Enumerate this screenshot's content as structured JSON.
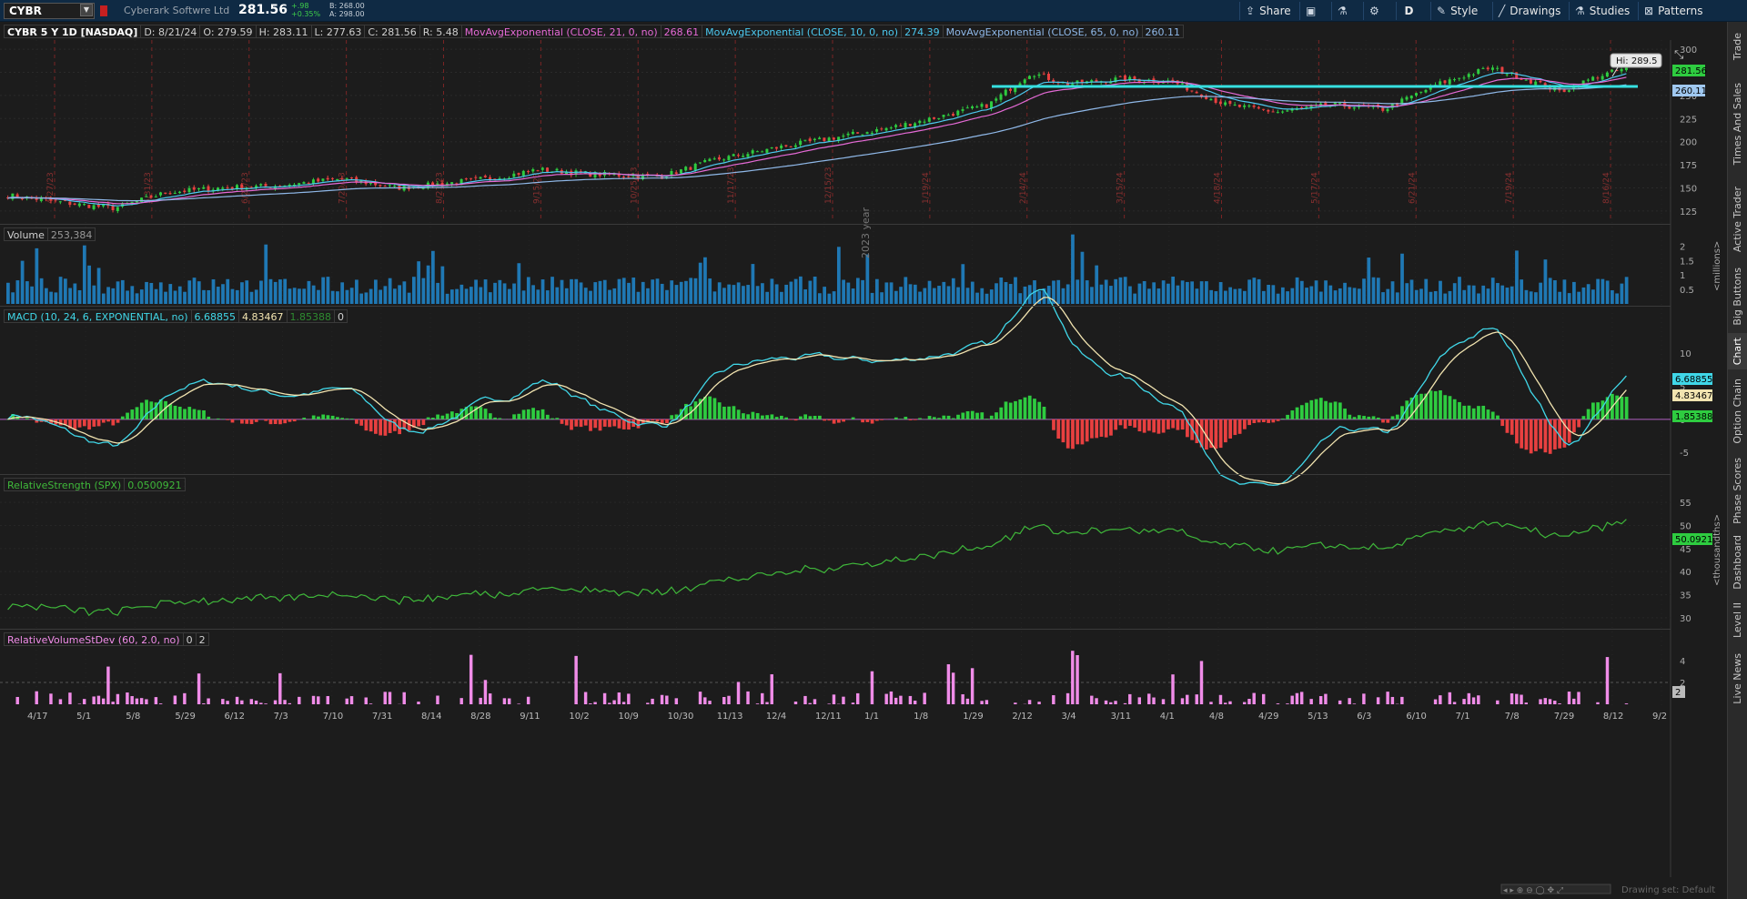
{
  "topbar": {
    "symbol": "CYBR",
    "company": "Cyberark Softwre Ltd",
    "last": "281.56",
    "change_abs": "+.98",
    "change_pct": "+0.35%",
    "bid": "B: 268.00",
    "ask": "A: 298.00",
    "buttons": {
      "share": "Share",
      "aggregation": "D",
      "style": "Style",
      "drawings": "Drawings",
      "studies": "Studies",
      "patterns": "Patterns"
    }
  },
  "sidebar": {
    "tabs": [
      "Trade",
      "Times And Sales",
      "Active Trader",
      "Big Buttons",
      "Chart",
      "Option Chain",
      "Phase Scores",
      "Dashboard",
      "Level II",
      "Live News"
    ]
  },
  "price_header": {
    "title": "CYBR 5 Y 1D [NASDAQ]",
    "date": "D: 8/21/24",
    "open": "O: 279.59",
    "high": "H: 283.11",
    "low": "L: 277.63",
    "close": "C: 281.56",
    "range": "R: 5.48",
    "ema21_label": "MovAvgExponential (CLOSE, 21, 0, no)",
    "ema21_value": "268.61",
    "ema10_label": "MovAvgExponential (CLOSE, 10, 0, no)",
    "ema10_value": "274.39",
    "ema65_label": "MovAvgExponential (CLOSE, 65, 0, no)",
    "ema65_value": "260.11"
  },
  "price_pane": {
    "hi_label": "Hi: 289.5",
    "last_badge": "281.56",
    "ema_badge": "260.11",
    "y_ticks": [
      "300",
      "275",
      "250",
      "225",
      "200",
      "175",
      "150",
      "125"
    ],
    "y_tick_values": [
      300,
      275,
      250,
      225,
      200,
      175,
      150,
      125
    ],
    "year_label": "2023 year",
    "earnings_markers": [
      "4/27/23",
      "5/31/23",
      "6/23/23",
      "7/20/23",
      "8/21/23",
      "9/15/23",
      "10/25/23",
      "11/17/23",
      "12/15/23",
      "1/19/24",
      "2/14/24",
      "3/15/24",
      "4/18/24",
      "5/17/24",
      "6/21/24",
      "7/19/24",
      "8/16/24"
    ]
  },
  "volume_header": {
    "label": "Volume",
    "value": "253,384"
  },
  "volume_pane": {
    "y_ticks": [
      "2",
      "1.5",
      "1",
      "0.5"
    ],
    "unit": "<millions>"
  },
  "macd_header": {
    "label": "MACD (10, 24, 6, EXPONENTIAL, no)",
    "value": "6.68855",
    "avg": "4.83467",
    "diff": "1.85388",
    "zero": "0"
  },
  "macd_pane": {
    "y_ticks": [
      "10",
      "5",
      "0",
      "-5"
    ],
    "badges": {
      "value": "6.68855",
      "avg": "4.83467",
      "diff": "1.85388"
    }
  },
  "rs_header": {
    "label": "RelativeStrength (SPX)",
    "value": "0.0500921"
  },
  "rs_pane": {
    "y_ticks": [
      "55",
      "50",
      "45",
      "40",
      "35",
      "30"
    ],
    "badge": "50.0921",
    "unit": "<thousandths>"
  },
  "rvol_header": {
    "label": "RelativeVolumeStDev (60, 2.0, no)",
    "v1": "0",
    "v2": "2"
  },
  "rvol_pane": {
    "y_ticks": [
      "4",
      "2"
    ],
    "badge": "2"
  },
  "x_axis": {
    "labels": [
      "4/17",
      "5/1",
      "5/8",
      "5/29",
      "6/12",
      "7/3",
      "7/10",
      "7/31",
      "8/14",
      "8/28",
      "9/11",
      "10/2",
      "10/9",
      "10/30",
      "11/13",
      "12/4",
      "12/11",
      "1/1",
      "1/8",
      "1/29",
      "2/12",
      "3/4",
      "3/11",
      "4/1",
      "4/8",
      "4/29",
      "5/13",
      "6/3",
      "6/10",
      "7/1",
      "7/8",
      "7/29",
      "8/12",
      "9/2"
    ]
  },
  "footer": {
    "drawing_set": "Drawing set: Default"
  },
  "colors": {
    "up": "#2ecc40",
    "down": "#e84040",
    "ema10": "#4cc9f0",
    "ema21": "#e56ad6",
    "ema65": "#8fb8e8",
    "macd": "#40d7e8",
    "macd_avg": "#f2e4b0",
    "rs": "#3fb83a",
    "rvol": "#f08ce8",
    "hline": "#36e0e0"
  }
}
